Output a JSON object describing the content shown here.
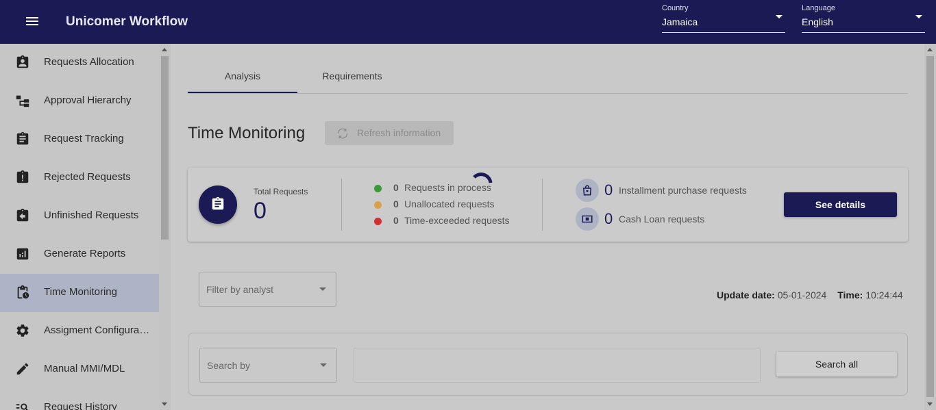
{
  "header": {
    "title": "Unicomer Workflow",
    "country": {
      "label": "Country",
      "value": "Jamaica"
    },
    "language": {
      "label": "Language",
      "value": "English"
    }
  },
  "sidebar": {
    "items": [
      {
        "label": "Requests Allocation",
        "icon": "assignment-ind-icon"
      },
      {
        "label": "Approval Hierarchy",
        "icon": "hierarchy-icon"
      },
      {
        "label": "Request Tracking",
        "icon": "assignment-icon"
      },
      {
        "label": "Rejected Requests",
        "icon": "assignment-late-icon"
      },
      {
        "label": "Unfinished Requests",
        "icon": "assignment-return-icon"
      },
      {
        "label": "Generate Reports",
        "icon": "analytics-icon"
      },
      {
        "label": "Time Monitoring",
        "icon": "pending-actions-icon",
        "active": true
      },
      {
        "label": "Assigment Configuration",
        "icon": "gear-icon"
      },
      {
        "label": "Manual MMI/MDL",
        "icon": "pencil-icon"
      },
      {
        "label": "Request History",
        "icon": "manage-search-icon"
      }
    ]
  },
  "tabs": [
    {
      "label": "Analysis",
      "active": true
    },
    {
      "label": "Requirements",
      "active": false
    }
  ],
  "page": {
    "title": "Time Monitoring",
    "refresh_label": "Refresh information"
  },
  "summary": {
    "total_label": "Total Requests",
    "total_value": "0",
    "statuses": [
      {
        "count": "0",
        "label": "Requests in process",
        "color": "#3a9a3a"
      },
      {
        "count": "0",
        "label": "Unallocated requests",
        "color": "#d9a04a"
      },
      {
        "count": "0",
        "label": "Time-exceeded requests",
        "color": "#d03030"
      }
    ],
    "request_types": [
      {
        "count": "0",
        "label": "Installment purchase requests",
        "icon": "shopping-bag-icon"
      },
      {
        "count": "0",
        "label": "Cash Loan requests",
        "icon": "cash-icon"
      }
    ],
    "details_label": "See details"
  },
  "filter": {
    "placeholder": "Filter by analyst"
  },
  "update": {
    "date_label": "Update date:",
    "date_value": "05-01-2024",
    "time_label": "Time:",
    "time_value": "10:24:44"
  },
  "search": {
    "by_placeholder": "Search by",
    "input_value": "",
    "all_label": "Search all"
  },
  "colors": {
    "primary": "#1b1a54",
    "active_nav": "#aeb4c6"
  }
}
